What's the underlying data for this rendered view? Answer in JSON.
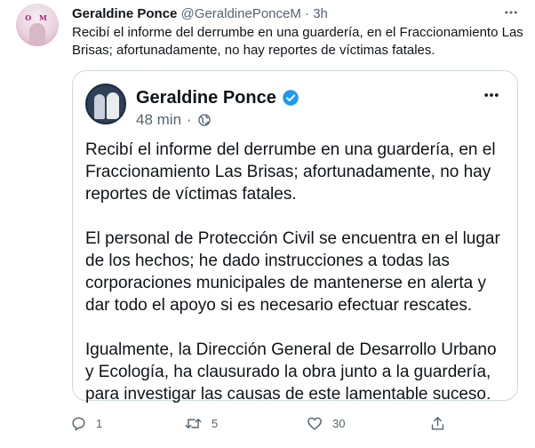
{
  "tweet": {
    "author_name": "Geraldine Ponce",
    "author_handle": "@GeraldinePonceM",
    "separator": "·",
    "time": "3h",
    "text": "Recibí el informe del derrumbe en una guardería, en el Fraccionamiento Las Brisas; afortunadamente, no hay reportes de víctimas fatales.",
    "avatar_badge_text": "O M"
  },
  "quoted": {
    "author_name": "Geraldine Ponce",
    "time": "48 min",
    "separator": "·",
    "paragraphs": [
      "Recibí el informe del derrumbe en una guardería, en el Fraccionamiento Las Brisas; afortunadamente, no hay reportes de víctimas fatales.",
      "El personal de Protección Civil se encuentra en el lugar de los hechos; he dado instrucciones a todas las corporaciones municipales de mantenerse en alerta y dar todo el apoyo si es necesario efectuar rescates.",
      "Igualmente, la Dirección General de Desarrollo Urbano y Ecología, ha clausurado la obra junto a la guardería, para investigar las causas de este lamentable suceso."
    ]
  },
  "actions": {
    "reply_count": "1",
    "retweet_count": "5",
    "like_count": "30"
  },
  "icons": {
    "verified": "verified-badge-icon",
    "globe": "globe-icon",
    "more": "more-icon",
    "reply": "reply-icon",
    "retweet": "retweet-icon",
    "like": "like-icon",
    "share": "share-icon"
  },
  "colors": {
    "verified": "#1d9bf0",
    "muted": "#536471",
    "border": "#cfd9de"
  }
}
